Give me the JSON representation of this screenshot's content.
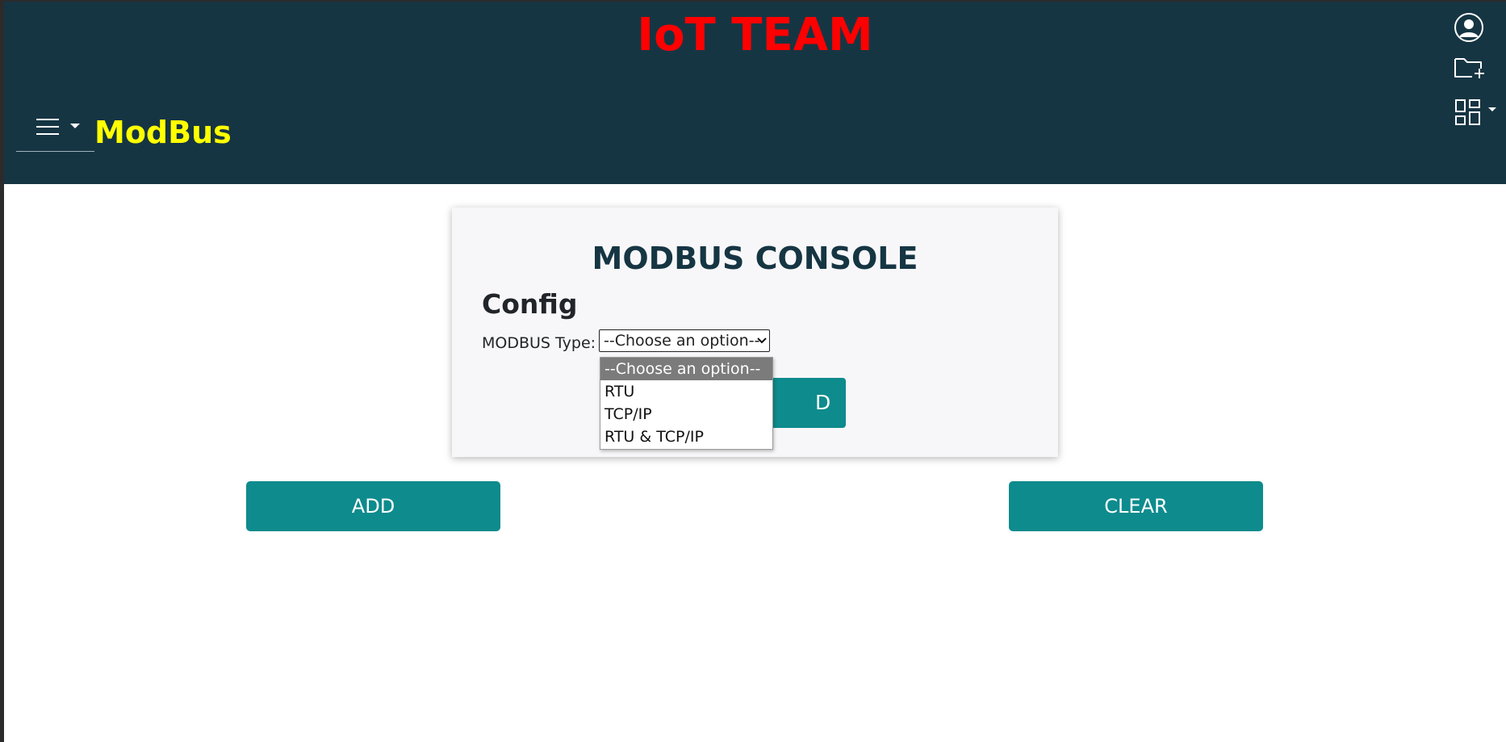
{
  "header": {
    "team_title": "IoT TEAM",
    "brand": "ModBus",
    "background_color": "#163543",
    "team_title_color": "#ff0000",
    "brand_color": "#ffff00",
    "menu_icon": "hamburger-icon",
    "right_icons": [
      "user-circle-icon",
      "folder-add-icon",
      "grid-layout-icon"
    ]
  },
  "console": {
    "title": "MODBUS CONSOLE",
    "config_heading": "Config",
    "modbus_type_label": "MODBUS Type:",
    "modbus_type_selected": "--Choose an option--",
    "modbus_type_options": [
      "--Choose an option--",
      "RTU",
      "TCP/IP",
      "RTU & TCP/IP"
    ],
    "partially_hidden_button_text": "D"
  },
  "actions": {
    "add_label": "ADD",
    "clear_label": "CLEAR",
    "button_color": "#0e8b8d"
  }
}
